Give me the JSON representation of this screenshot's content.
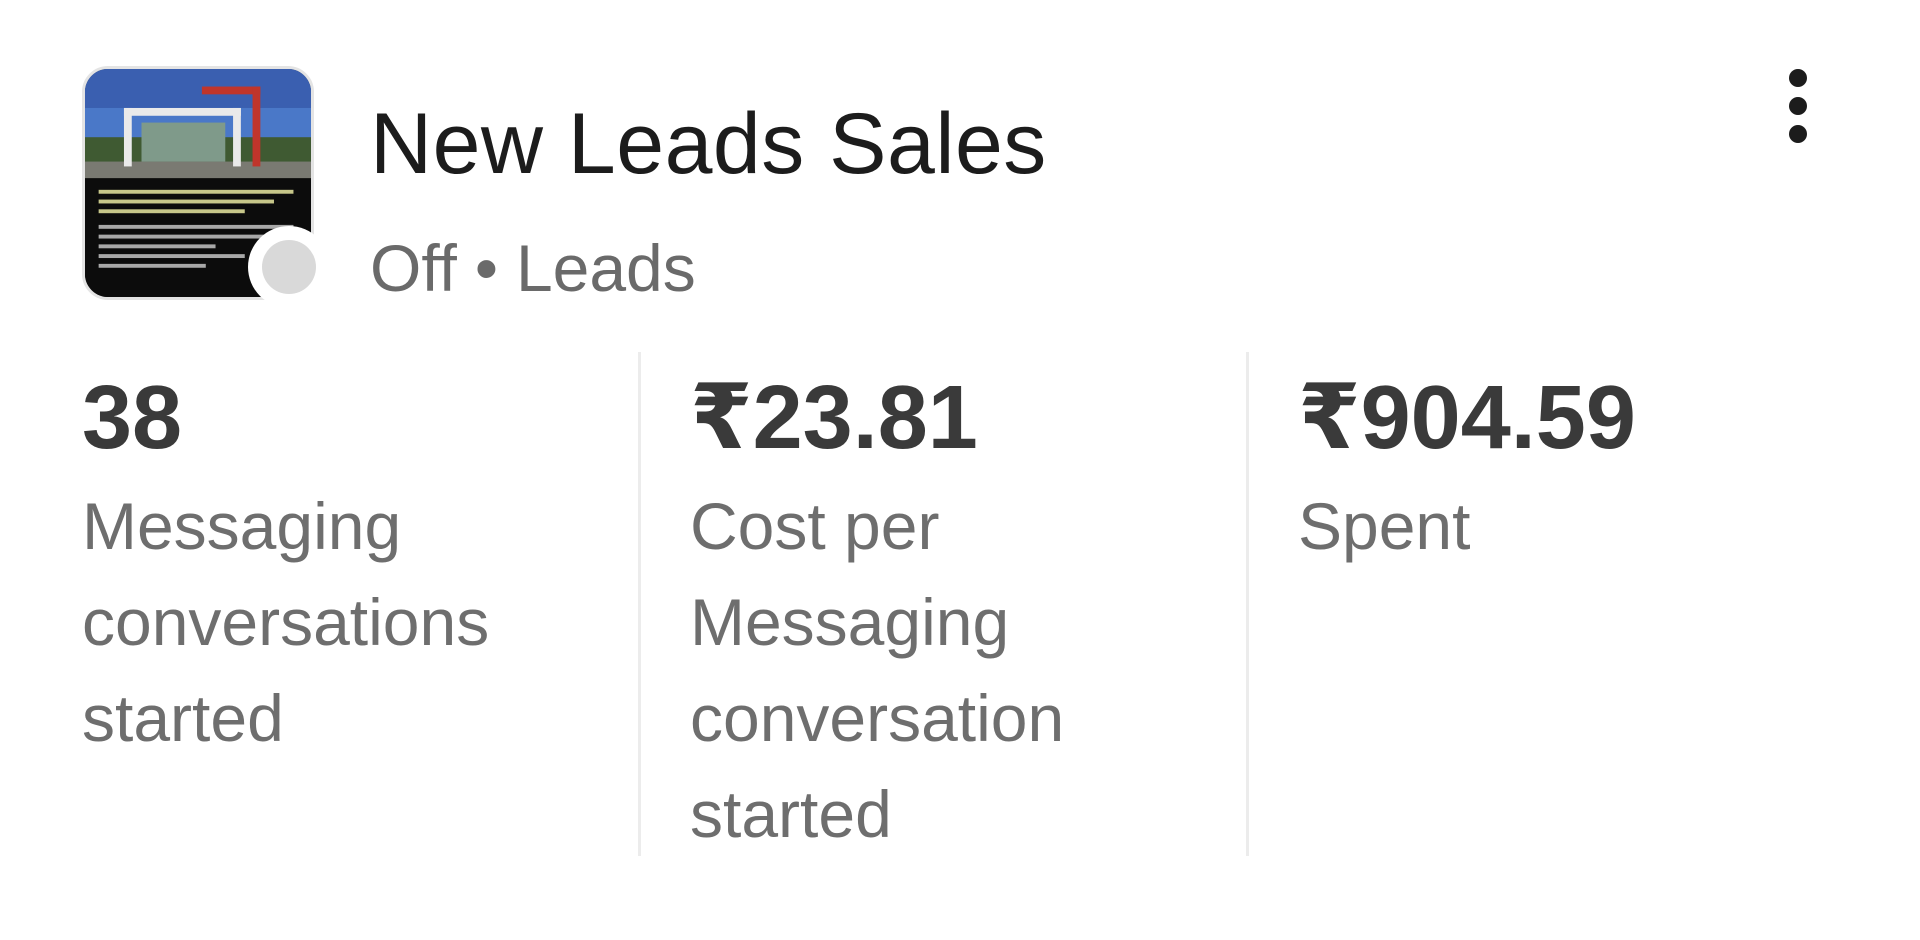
{
  "campaign": {
    "title": "New Leads Sales",
    "status": "Off",
    "separator": "•",
    "objective": "Leads",
    "status_color": "#d9d9d9"
  },
  "metrics": [
    {
      "value": "38",
      "label": "Messaging conversations started"
    },
    {
      "value": "₹23.81",
      "label": "Cost per Messaging conversation started"
    },
    {
      "value": "₹904.59",
      "label": "Spent"
    }
  ],
  "icons": {
    "thumbnail": "ad-thumbnail-image",
    "status": "status-dot-icon",
    "menu": "more-vertical-icon"
  }
}
